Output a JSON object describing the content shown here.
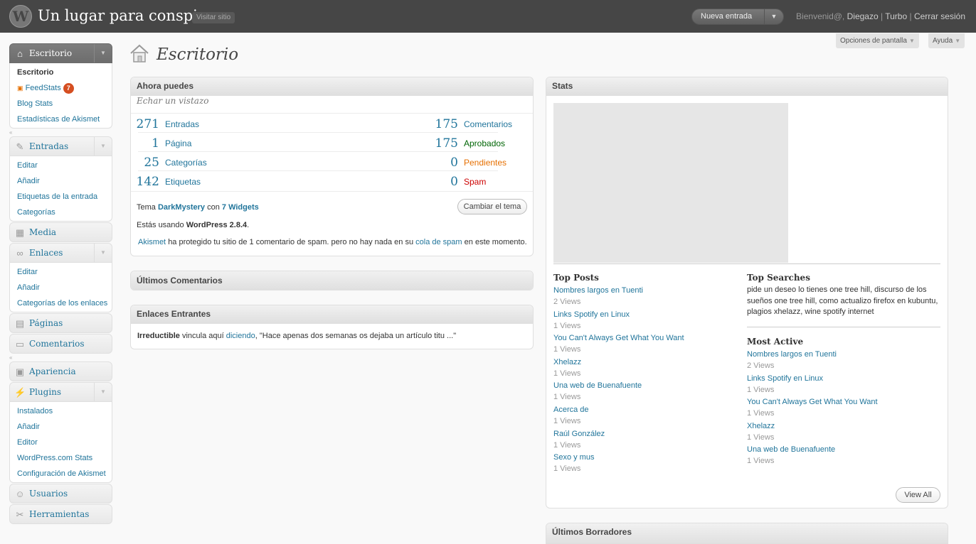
{
  "header": {
    "site_title": "Un lugar para conspirar",
    "visit_site": "Visitar sitio",
    "favorite_action": "Nueva entrada",
    "greeting": "Bienvenid@,",
    "user": "Diegazo",
    "turbo": "Turbo",
    "logout": "Cerrar sesión"
  },
  "screen_meta": {
    "options": "Opciones de pantalla",
    "help": "Ayuda"
  },
  "page_title": "Escritorio",
  "menu": {
    "dashboard": {
      "label": "Escritorio",
      "items": [
        "Escritorio",
        "FeedStats",
        "Blog Stats",
        "Estadísticas de Akismet"
      ],
      "feedstats_badge": "7"
    },
    "posts": {
      "label": "Entradas",
      "items": [
        "Editar",
        "Añadir",
        "Etiquetas de la entrada",
        "Categorías"
      ]
    },
    "media": {
      "label": "Media"
    },
    "links": {
      "label": "Enlaces",
      "items": [
        "Editar",
        "Añadir",
        "Categorías de los enlaces"
      ]
    },
    "pages": {
      "label": "Páginas"
    },
    "comments": {
      "label": "Comentarios"
    },
    "appearance": {
      "label": "Apariencia"
    },
    "plugins": {
      "label": "Plugins",
      "items": [
        "Instalados",
        "Añadir",
        "Editor",
        "WordPress.com Stats",
        "Configuración de Akismet"
      ]
    },
    "users": {
      "label": "Usuarios"
    },
    "tools": {
      "label": "Herramientas"
    }
  },
  "right_now": {
    "title": "Ahora puedes",
    "subtitle": "Echar un vistazo",
    "content": [
      {
        "num": "271",
        "label": "Entradas"
      },
      {
        "num": "1",
        "label": "Página"
      },
      {
        "num": "25",
        "label": "Categorías"
      },
      {
        "num": "142",
        "label": "Etiquetas"
      }
    ],
    "discussion": [
      {
        "num": "175",
        "label": "Comentarios"
      },
      {
        "num": "175",
        "label": "Aprobados"
      },
      {
        "num": "0",
        "label": "Pendientes"
      },
      {
        "num": "0",
        "label": "Spam"
      }
    ],
    "theme_prefix": "Tema",
    "theme_name": "DarkMystery",
    "theme_con": "con",
    "widgets": "7 Widgets",
    "change_theme": "Cambiar el tema",
    "version_prefix": "Estás usando",
    "version": "WordPress 2.8.4",
    "akismet": "Akismet",
    "akismet_text": "ha protegido tu sitio de 1 comentario de spam. pero no hay nada en su",
    "spam_queue": "cola de spam",
    "akismet_tail": "en este momento."
  },
  "recent_comments": {
    "title": "Últimos Comentarios"
  },
  "incoming_links": {
    "title": "Enlaces Entrantes",
    "source": "Irreductible",
    "text": "vincula aquí",
    "link": "diciendo",
    "quote": ", \"Hace apenas dos semanas os dejaba un artículo titu ...\""
  },
  "stats": {
    "title": "Stats",
    "top_posts_title": "Top Posts",
    "top_posts": [
      {
        "title": "Nombres largos en Tuenti",
        "views": "2 Views"
      },
      {
        "title": "Links Spotify en Linux",
        "views": "1 Views"
      },
      {
        "title": "You Can't Always Get What You Want",
        "views": "1 Views"
      },
      {
        "title": "Xhelazz",
        "views": "1 Views"
      },
      {
        "title": "Una web de Buenafuente",
        "views": "1 Views"
      },
      {
        "title": "Acerca de",
        "views": "1 Views"
      },
      {
        "title": "Raúl González",
        "views": "1 Views"
      },
      {
        "title": "Sexo y mus",
        "views": "1 Views"
      }
    ],
    "top_searches_title": "Top Searches",
    "top_searches": "pide un deseo lo tienes one tree hill,  discurso de los sueños one tree hill,  como actualizo firefox en kubuntu,  plagios xhelazz,  wine spotify internet",
    "most_active_title": "Most Active",
    "most_active": [
      {
        "title": "Nombres largos en Tuenti",
        "views": "2 Views"
      },
      {
        "title": "Links Spotify en Linux",
        "views": "1 Views"
      },
      {
        "title": "You Can't Always Get What You Want",
        "views": "1 Views"
      },
      {
        "title": "Xhelazz",
        "views": "1 Views"
      },
      {
        "title": "Una web de Buenafuente",
        "views": "1 Views"
      }
    ],
    "view_all": "View All"
  },
  "recent_drafts": {
    "title": "Últimos Borradores"
  }
}
